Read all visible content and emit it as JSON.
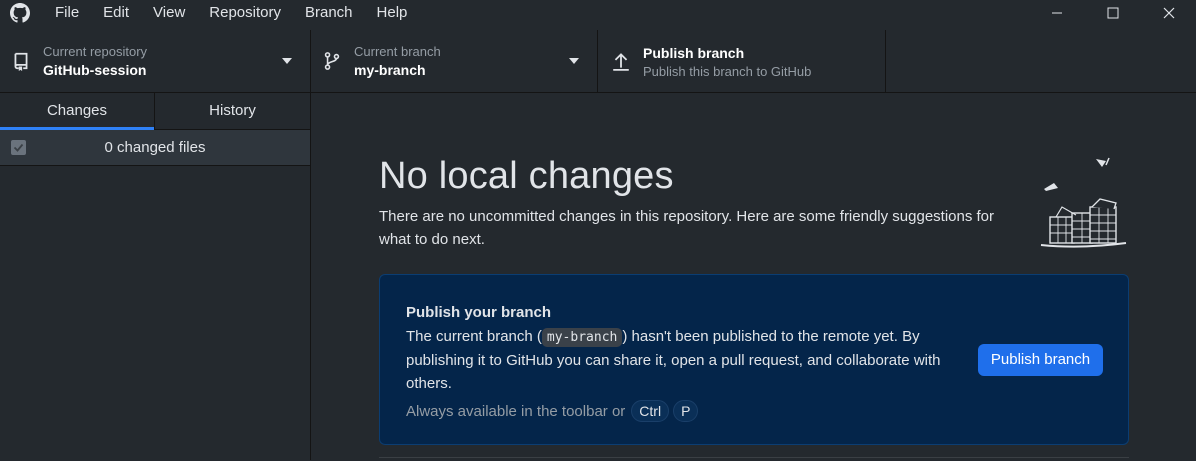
{
  "menu": {
    "items": [
      "File",
      "Edit",
      "View",
      "Repository",
      "Branch",
      "Help"
    ]
  },
  "toolbar": {
    "repository": {
      "label": "Current repository",
      "value": "GitHub-session"
    },
    "branch": {
      "label": "Current branch",
      "value": "my-branch"
    },
    "publish": {
      "label": "Publish branch",
      "description": "Publish this branch to GitHub"
    }
  },
  "sidebar": {
    "tabs": [
      {
        "label": "Changes",
        "active": true
      },
      {
        "label": "History",
        "active": false
      }
    ],
    "changed_files_label": "0 changed files"
  },
  "main": {
    "title": "No local changes",
    "subtitle": "There are no uncommitted changes in this repository. Here are some friendly suggestions for what to do next.",
    "card": {
      "title": "Publish your branch",
      "desc_before": "The current branch (",
      "branch_code": "my-branch",
      "desc_after": ") hasn't been published to the remote yet. By publishing it to GitHub you can share it, open a pull request, and collaborate with others.",
      "hint_text": "Always available in the toolbar or",
      "hint_keys": [
        "Ctrl",
        "P"
      ],
      "button_label": "Publish branch"
    }
  },
  "colors": {
    "background": "#24292e",
    "card_background": "#04254a",
    "accent": "#1f6feb",
    "tab_indicator": "#2f81f7"
  },
  "icons": {
    "app": "github-logo-icon",
    "repo": "repository-icon",
    "branch": "git-branch-icon",
    "publish": "upload-arrow-icon",
    "caret": "chevron-down-icon"
  }
}
